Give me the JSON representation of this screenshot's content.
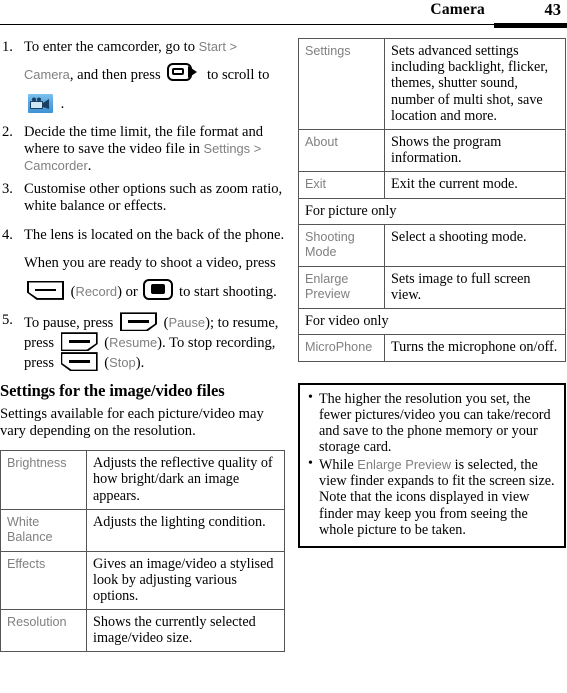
{
  "header": {
    "title": "Camera",
    "page_number": "43"
  },
  "left_column": {
    "steps": [
      {
        "num": "1.",
        "parts": [
          {
            "t": "text",
            "v": "To enter the camcorder, go to "
          },
          {
            "t": "ui",
            "v": "Start"
          },
          {
            "t": "sep",
            "v": " > "
          },
          {
            "t": "ui",
            "v": "Camera"
          },
          {
            "t": "text",
            "v": ", and then press "
          },
          {
            "t": "icon",
            "v": "nav-right-key-icon"
          },
          {
            "t": "text",
            "v": " to scroll to "
          },
          {
            "t": "icon",
            "v": "camcorder-app-icon"
          },
          {
            "t": "text",
            "v": " ."
          }
        ]
      },
      {
        "num": "2.",
        "parts": [
          {
            "t": "text",
            "v": "Decide the time limit, the file format and where to save the video file in "
          },
          {
            "t": "ui",
            "v": "Settings"
          },
          {
            "t": "sep",
            "v": " > "
          },
          {
            "t": "ui",
            "v": "Camcorder"
          },
          {
            "t": "text",
            "v": "."
          }
        ]
      },
      {
        "num": "3.",
        "parts": [
          {
            "t": "text",
            "v": "Customise other options such as zoom ratio, white balance or effects."
          }
        ]
      },
      {
        "num": "4.",
        "parts": [
          {
            "t": "text",
            "v": "The lens is located on the back of the phone. When you are ready to shoot a video, press "
          },
          {
            "t": "icon",
            "v": "left-soft-key-icon"
          },
          {
            "t": "text",
            "v": " ("
          },
          {
            "t": "ui",
            "v": "Record"
          },
          {
            "t": "text",
            "v": ") or "
          },
          {
            "t": "icon",
            "v": "enter-key-icon"
          },
          {
            "t": "text",
            "v": " to start shooting."
          }
        ]
      },
      {
        "num": "5.",
        "parts": [
          {
            "t": "text",
            "v": "To pause, press "
          },
          {
            "t": "icon",
            "v": "right-soft-key-icon"
          },
          {
            "t": "text",
            "v": " ("
          },
          {
            "t": "ui",
            "v": "Pause"
          },
          {
            "t": "text",
            "v": "); to resume, press "
          },
          {
            "t": "icon",
            "v": "right-soft-key-icon"
          },
          {
            "t": "text",
            "v": " ("
          },
          {
            "t": "ui",
            "v": "Resume"
          },
          {
            "t": "text",
            "v": "). To stop recording, press "
          },
          {
            "t": "icon",
            "v": "left-soft-key-icon"
          },
          {
            "t": "text",
            "v": " ("
          },
          {
            "t": "ui",
            "v": "Stop"
          },
          {
            "t": "text",
            "v": ")."
          }
        ]
      }
    ],
    "section_heading": "Settings for the image/video files",
    "section_paragraph": "Settings available for each picture/video may vary depending on the resolution.",
    "settings_table": [
      {
        "label": "Brightness",
        "description": "Adjusts the reflective quality of how bright/dark an image appears."
      },
      {
        "label": "White Balance",
        "description": "Adjusts the lighting condition."
      },
      {
        "label": "Effects",
        "description": "Gives an image/video a stylised look by adjusting various options."
      },
      {
        "label": "Resolution",
        "description": "Shows the currently selected image/video size."
      }
    ]
  },
  "right_column": {
    "options_table": [
      {
        "kind": "row",
        "label": "Settings",
        "description": "Sets advanced settings including backlight, flicker, themes, shutter sound, number of multi shot, save location and more."
      },
      {
        "kind": "row",
        "label": "About",
        "description": "Shows the program information."
      },
      {
        "kind": "row",
        "label": "Exit",
        "description": "Exit the current mode."
      },
      {
        "kind": "full",
        "label": "For picture only"
      },
      {
        "kind": "row",
        "label": "Shooting Mode",
        "description": "Select a shooting mode."
      },
      {
        "kind": "row",
        "label": "Enlarge Preview",
        "description": "Sets image to full screen view."
      },
      {
        "kind": "full",
        "label": "For video only"
      },
      {
        "kind": "row",
        "label": "MicroPhone",
        "description": "Turns the microphone on/off."
      }
    ],
    "note_box": [
      {
        "parts": [
          {
            "t": "text",
            "v": "The higher the resolution you set, the fewer pictures/video you can take/record and save to the phone memory or your storage card."
          }
        ]
      },
      {
        "parts": [
          {
            "t": "text",
            "v": "While "
          },
          {
            "t": "ui",
            "v": "Enlarge Preview"
          },
          {
            "t": "text",
            "v": " is selected, the view finder expands to fit the screen size. Note that the icons displayed in view finder may keep you from seeing the whole picture to be taken."
          }
        ]
      }
    ],
    "bullet_glyph": "•"
  },
  "colors": {
    "ui_label_grey": "#808080",
    "text_black": "#000000",
    "icon_blue": "#58a8e2",
    "table_border": "#555555"
  }
}
